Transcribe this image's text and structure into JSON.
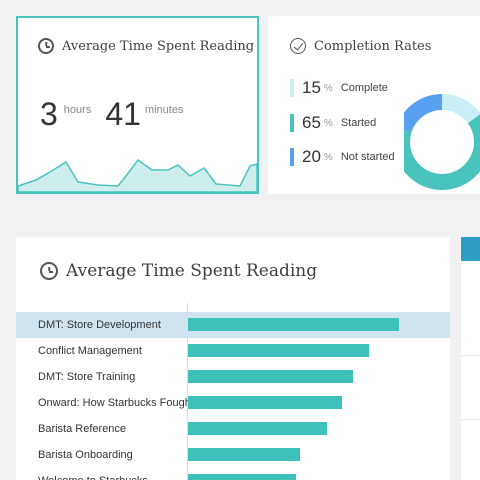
{
  "reading_card": {
    "title": "Average Time Spent Reading",
    "hours_value": "3",
    "hours_unit": "hours",
    "minutes_value": "41",
    "minutes_unit": "minutes",
    "accent_color": "#49c3bd"
  },
  "completion_card": {
    "title": "Completion Rates",
    "items": [
      {
        "value": "15",
        "pct": "%",
        "label": "Complete",
        "color": "#c9eef6"
      },
      {
        "value": "65",
        "pct": "%",
        "label": "Started",
        "color": "#49c3bd"
      },
      {
        "value": "20",
        "pct": "%",
        "label": "Not started",
        "color": "#5aa0f0"
      }
    ],
    "donut": [
      {
        "name": "Complete",
        "value": 15,
        "color": "#c9eef6"
      },
      {
        "name": "Started",
        "value": 65,
        "color": "#49c3bd"
      },
      {
        "name": "Not started",
        "value": 20,
        "color": "#5aa0f0"
      }
    ]
  },
  "detail_card": {
    "title": "Average Time Spent Reading"
  },
  "chart_data": {
    "type": "bar",
    "orientation": "horizontal",
    "categories": [
      "DMT: Store Development",
      "Conflict Management",
      "DMT: Store Training",
      "Onward: How Starbucks Fought for Its Life",
      "Barista Reference",
      "Barista Onboarding",
      "Welcome to Starbucks"
    ],
    "values": [
      100,
      86,
      78,
      73,
      66,
      53,
      51
    ],
    "highlighted_index": 0,
    "bar_color": "#3fc1bb"
  }
}
